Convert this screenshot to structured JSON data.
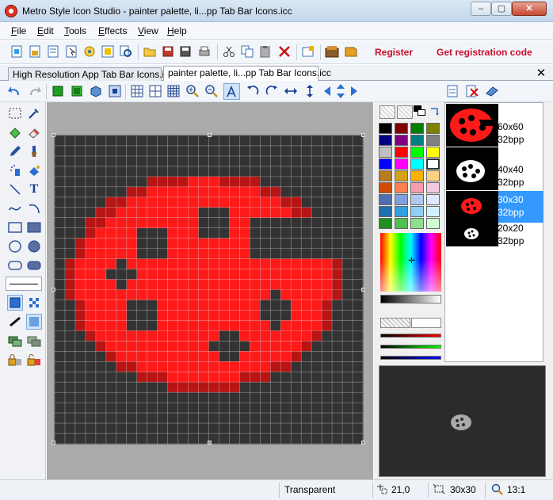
{
  "window": {
    "title": "Metro Style Icon Studio - painter palette, li...pp Tab Bar Icons.icc",
    "min_label": "–",
    "max_label": "▢",
    "close_label": "✕"
  },
  "menu": [
    "File",
    "Edit",
    "Tools",
    "Effects",
    "View",
    "Help"
  ],
  "toolbar": {
    "register_label": "Register",
    "get_code_label": "Get registration code"
  },
  "tabs": [
    {
      "label": "High Resolution App Tab Bar Icons.icc",
      "active": false
    },
    {
      "label": "painter palette, li...pp Tab Bar Icons.icc",
      "active": true
    }
  ],
  "tab_close_label": "✕",
  "canvas": {
    "grid_size": 30,
    "background_color": "#333333",
    "pixel_color": "#ff1a1a",
    "edge_color": "#b81414"
  },
  "palette": {
    "swatches": [
      "#000000",
      "#800000",
      "#008000",
      "#808000",
      "#000080",
      "#800080",
      "#008080",
      "#808080",
      "#c0c0c0",
      "#ff0000",
      "#00ff00",
      "#ffff00",
      "#0000ff",
      "#ff00ff",
      "#00ffff",
      "#ffffff",
      "#b97a22",
      "#d4a017",
      "#ffb000",
      "#ffd27f",
      "#d24a00",
      "#ff7f50",
      "#f79db0",
      "#f3c8e0",
      "#4f6fb0",
      "#7f9fe0",
      "#b0c8f0",
      "#dfe8ff",
      "#1f6fb0",
      "#2f9fe0",
      "#8fd0f0",
      "#d0f0ff",
      "#1f8f1f",
      "#4fbf4f",
      "#8fdf8f",
      "#d0ffd0"
    ],
    "selected_index": 15
  },
  "formats": [
    {
      "size": "60x60",
      "depth": "32bpp",
      "selected": false
    },
    {
      "size": "40x40",
      "depth": "32bpp",
      "selected": false
    },
    {
      "size": "30x30",
      "depth": "32bpp",
      "selected": true
    },
    {
      "size": "20x20",
      "depth": "32bpp",
      "selected": false
    }
  ],
  "status": {
    "color_name": "Transparent",
    "cursor": "21,0",
    "image_size": "30x30",
    "zoom": "13:1"
  },
  "icons": {
    "toolbar": [
      "new-icon",
      "new-from-image-icon",
      "new-icon-library-icon",
      "extract-icon",
      "capture-icon",
      "batch-icon",
      "open-icon",
      "save-icon",
      "save-all-icon",
      "print-icon",
      "cut-icon",
      "copy-icon",
      "paste-icon",
      "delete-icon",
      "properties-icon",
      "library-icon",
      "register-book-icon"
    ],
    "edit_toolbar": [
      "undo-icon",
      "redo-icon",
      "green-cube-icon",
      "green-cube-2-icon",
      "blue-cube-icon",
      "blue-square-icon",
      "grid-icon",
      "grid-2-icon",
      "grid-3-icon",
      "zoom-in-icon",
      "zoom-out-icon",
      "text-tool-icon",
      "rotate-left-icon",
      "rotate-right-icon",
      "flip-horizontal-icon",
      "flip-vertical-icon",
      "move-arrows-icon",
      "new-format-icon",
      "delete-format-icon",
      "eraser-icon"
    ],
    "tools": [
      "select-rect-icon",
      "eyedropper-icon",
      "fill-icon",
      "eraser-tool-icon",
      "pencil-icon",
      "brush-icon",
      "spray-icon",
      "color-replace-icon",
      "line-icon",
      "text-icon",
      "curve-icon",
      "arc-icon",
      "rect-icon",
      "filled-rect-icon",
      "ellipse-icon",
      "filled-ellipse-icon",
      "rounded-rect-icon",
      "filled-rounded-rect-icon",
      "line-width-icon",
      "blue-square-icon",
      "pattern-icon",
      "brush-size-icon",
      "soft-brush-icon",
      "layers-icon",
      "layers-2-icon",
      "lock-icon",
      "lock-2-icon"
    ]
  }
}
